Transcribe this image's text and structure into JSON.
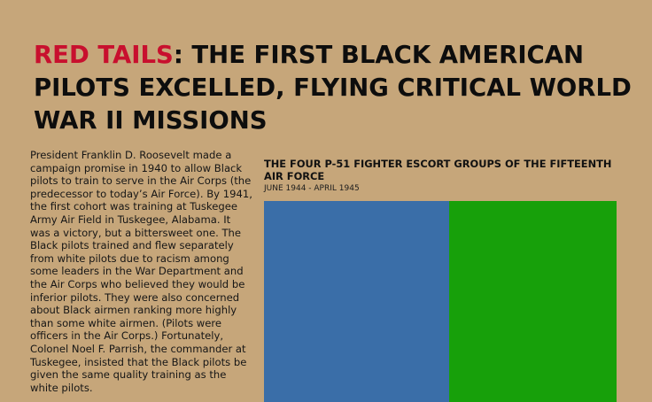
{
  "article": {
    "title_accent": "RED TAILS",
    "title_rest": ": THE FIRST BLACK AMERICAN PILOTS EXCELLED, FLYING CRITICAL WORLD WAR II MISSIONS",
    "body": "President Franklin D. Roosevelt made a campaign promise in 1940 to allow Black pilots to train to serve in the Air Corps (the predecessor to today’s Air Force). By 1941, the first cohort was training at Tuskegee Army Air Field in Tuskegee, Alabama. It was a victory, but a bittersweet one. The Black pilots trained and flew separately from white pilots due to racism among some leaders in the War Department and the Air Corps who believed they would be inferior pilots. They were also concerned about Black airmen ranking more highly than some white airmen. (Pilots were officers in the Air Corps.) Fortunately, Colonel Noel F. Parrish, the commander at Tuskegee, insisted that the Black pilots be given the same quality training as the white pilots."
  },
  "graphic": {
    "title": "THE FOUR P-51 FIGHTER ESCORT GROUPS OF THE FIFTEENTH AIR FORCE",
    "subtitle": "JUNE 1944 - APRIL 1945",
    "blocks": [
      {
        "color": "#3a6ea8",
        "share": 0.525
      },
      {
        "color": "#17a00a",
        "share": 0.475
      }
    ]
  },
  "colors": {
    "background": "#c6a67a",
    "accent": "#c8102e"
  }
}
